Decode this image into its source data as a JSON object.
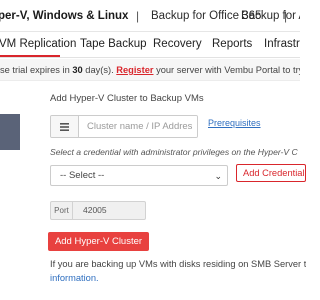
{
  "top_tabs": {
    "items": [
      {
        "label": "per-V, Windows & Linux",
        "active": true
      },
      {
        "label": "Backup for Office 365",
        "active": false
      },
      {
        "label": "Backup for AW",
        "active": false
      }
    ],
    "separator": "|"
  },
  "nav": {
    "items": [
      "VM Replication",
      "Tape Backup",
      "Recovery",
      "Reports",
      "Infrastru"
    ]
  },
  "trial_notice": {
    "prefix": "se trial expires in ",
    "days": "30",
    "after_days": " day(s). ",
    "register_link": "Register",
    "suffix": " your server with Vembu Portal to try"
  },
  "form": {
    "title": "Add Hyper-V Cluster to Backup VMs",
    "cluster_input_placeholder": "Cluster name / IP Addres",
    "cluster_input_value": "",
    "prerequisites_link": "Prerequisites",
    "credential_note": "Select a credential with administrator privileges on the Hyper-V C",
    "credential_select_value": "-- Select --",
    "add_credential_button": "Add Credential",
    "port_label": "Port",
    "port_value": "42005",
    "add_cluster_button": "Add Hyper-V Cluster",
    "info_text": "If you are backing up VMs with disks residing on SMB Server then a",
    "info_link": "information."
  },
  "colors": {
    "accent_red": "#d9262c",
    "button_red": "#e8413f",
    "link_blue": "#2f6fc0",
    "side_panel": "#5a6378"
  },
  "icons": {
    "cluster_addon": "list-icon",
    "select_chevron": "chevron-down-icon"
  }
}
